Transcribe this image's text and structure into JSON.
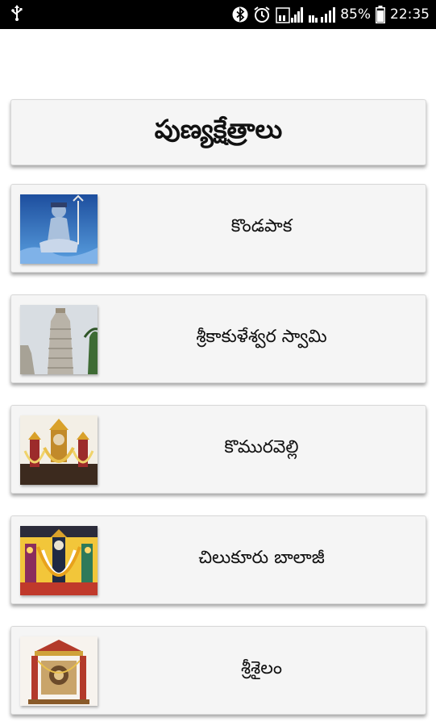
{
  "status_bar": {
    "battery_percent": "85%",
    "time": "22:35",
    "icons": [
      "usb-icon",
      "bluetooth-icon",
      "alarm-icon",
      "signal-icon",
      "signal-icon",
      "battery-icon"
    ]
  },
  "header": {
    "title": "పుణ్యక్షేత్రాలు"
  },
  "temples": [
    {
      "label": "కొండపాక"
    },
    {
      "label": "శ్రీకాకుళేశ్వర స్వామి"
    },
    {
      "label": "కొమురవెల్లి"
    },
    {
      "label": "చిలుకూరు బాలాజీ"
    },
    {
      "label": "శ్రీశైలం"
    }
  ]
}
